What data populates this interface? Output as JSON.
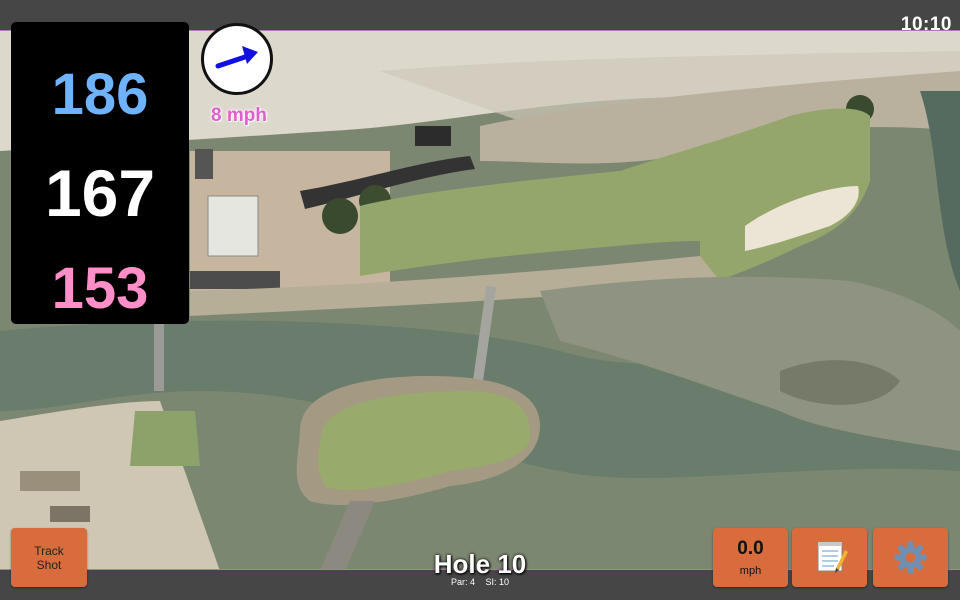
{
  "status_bar": {
    "time": "10:10"
  },
  "distances": {
    "back": "186",
    "middle": "167",
    "front": "153"
  },
  "wind": {
    "speed_label": "8 mph",
    "arrow_icon": "wind-arrow-icon",
    "arrow_color": "#1010e0"
  },
  "controls": {
    "track_shot": {
      "line1": "Track",
      "line2": "Shot"
    },
    "speed": {
      "value": "0.0",
      "unit": "mph"
    },
    "notes_icon": "notepad-icon",
    "settings_icon": "gear-icon"
  },
  "hole": {
    "title": "Hole 10",
    "par": "Par: 4",
    "stroke_index": "SI: 10"
  },
  "colors": {
    "button": "#d86c3c",
    "back_distance": "#6fb3ff",
    "middle_distance": "#ffffff",
    "front_distance": "#ff8ec9",
    "wind_text": "#e05fd0"
  }
}
